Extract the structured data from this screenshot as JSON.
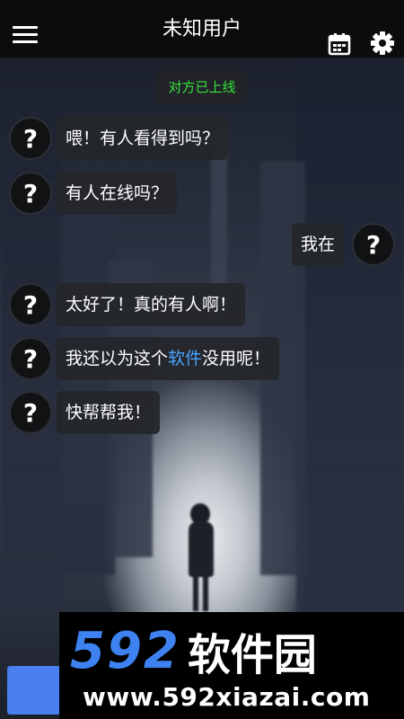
{
  "header": {
    "title": "未知用户",
    "menu_icon": "menu-icon",
    "calendar_icon": "calendar-icon",
    "settings_icon": "gear-icon"
  },
  "status": {
    "text": "对方已上线",
    "color": "#37e13c"
  },
  "messages": [
    {
      "side": "left",
      "avatar": "?",
      "text": "喂！有人看得到吗？"
    },
    {
      "side": "left",
      "avatar": "?",
      "text": "有人在线吗？"
    },
    {
      "side": "right",
      "avatar": "?",
      "text": "我在"
    },
    {
      "side": "left",
      "avatar": "?",
      "text": "太好了！真的有人啊！"
    },
    {
      "side": "left",
      "avatar": "?",
      "text_before": "我还以为这个",
      "highlight": "软件",
      "text_after": "没用呢！",
      "highlight_color": "#4aa3ff"
    },
    {
      "side": "left",
      "avatar": "?",
      "text": "快帮帮我！"
    }
  ],
  "watermark": {
    "number": "592",
    "brand": "软件园",
    "url": "www.592xiazai.com",
    "number_color": "#3d82f0"
  },
  "colors": {
    "topbar": "#0c0c0e",
    "bubble": "#24262a",
    "send_button": "#4a7ff2"
  }
}
